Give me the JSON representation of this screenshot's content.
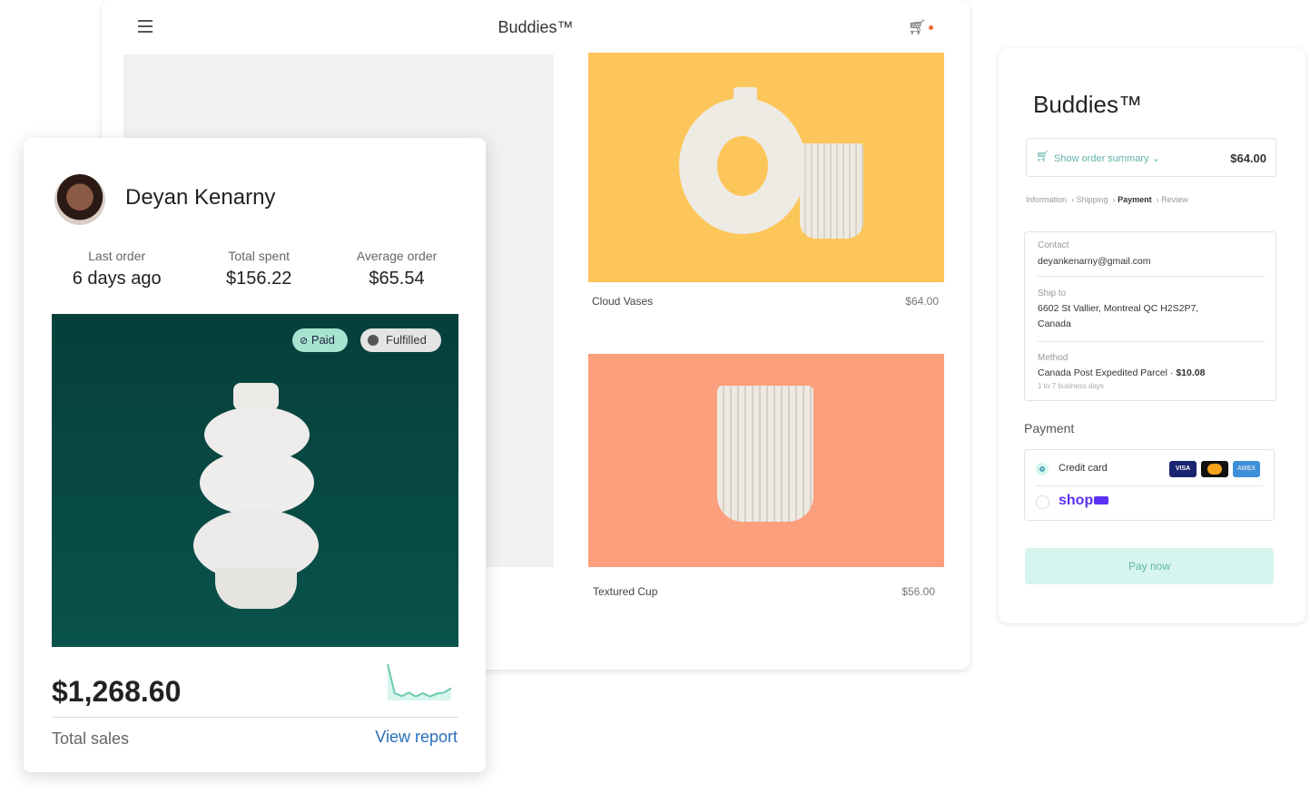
{
  "store": {
    "title": "Buddies™",
    "products": [
      {
        "name": "Cloud Vases",
        "price": "$64.00",
        "bg": "#fdc65a"
      },
      {
        "name": "Textured Cup",
        "price": "$56.00",
        "bg": "#fb9f7c"
      }
    ]
  },
  "customer": {
    "name": "Deyan Kenarny",
    "stats": [
      {
        "label": "Last order",
        "value": "6 days ago"
      },
      {
        "label": "Total spent",
        "value": "$156.22"
      },
      {
        "label": "Average order",
        "value": "$65.54"
      }
    ],
    "badges": {
      "paid": "Paid",
      "fulfilled": "Fulfilled"
    },
    "total_sales": "$1,268.60",
    "total_sales_label": "Total sales",
    "view_report": "View report",
    "sparkline": [
      10,
      2,
      1.2,
      2.2,
      1.1,
      2,
      1.1,
      1.9,
      2.2,
      3.4
    ]
  },
  "checkout": {
    "title": "Buddies™",
    "order_summary": "Show order summary",
    "order_total": "$64.00",
    "breadcrumb": [
      "Information",
      "Shipping",
      "Payment",
      "Review"
    ],
    "active_step": "Payment",
    "contact_label": "Contact",
    "contact": "deyankenarny@gmail.com",
    "ship_label": "Ship to",
    "ship_line1": "6602 St Vallier, Montreal QC  H2S2P7,",
    "ship_line2": "Canada",
    "method_label": "Method",
    "method": "Canada Post Expedited Parcel · ",
    "method_price": "$10.08",
    "method_note": "1 to 7 business days",
    "payment_label": "Payment",
    "credit_card": "Credit card",
    "cards": [
      "VISA",
      "MC",
      "AMEX"
    ],
    "shop_pay": "shop",
    "pay_now": "Pay now",
    "colors": {
      "accent": "#5fb3a8",
      "button_bg": "#d6f5ef",
      "shop": "#5a31f4"
    }
  }
}
